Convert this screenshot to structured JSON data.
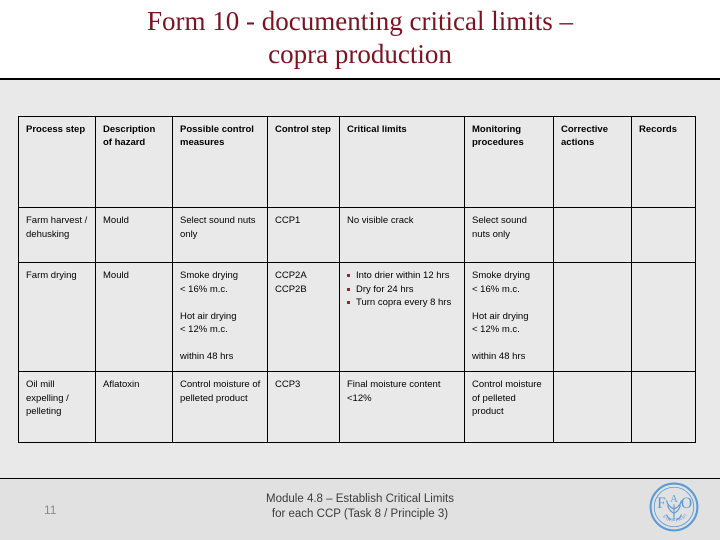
{
  "slide": {
    "title": "Form 10 - documenting critical limits –\ncopra production",
    "title_color": "#7b1220",
    "background_color": "#e9e9e9"
  },
  "table": {
    "headers": [
      "Process step",
      "Description of hazard",
      "Possible control measures",
      "Control step",
      "Critical limits",
      "Monitoring procedures",
      "Corrective actions",
      "Records"
    ],
    "rows": [
      {
        "process_step": "Farm harvest / dehusking",
        "description_of_hazard": "Mould",
        "possible_control_measures": "Select sound nuts only",
        "control_step": "CCP1",
        "critical_limits": "No visible crack",
        "critical_limits_bullets": [],
        "monitoring_procedures": "Select sound nuts only",
        "corrective_actions": "",
        "records": ""
      },
      {
        "process_step": "Farm drying",
        "description_of_hazard": "Mould",
        "possible_control_measures": "Smoke drying\n< 16% m.c.\n\nHot air drying\n< 12% m.c.\n\nwithin 48 hrs",
        "control_step": "CCP2A\nCCP2B",
        "critical_limits": "",
        "critical_limits_bullets": [
          "Into drier within 12 hrs",
          "Dry for 24 hrs",
          "Turn copra every 8 hrs"
        ],
        "monitoring_procedures": "Smoke drying\n< 16% m.c.\n\nHot air drying\n< 12% m.c.\n\nwithin 48 hrs",
        "corrective_actions": "",
        "records": ""
      },
      {
        "process_step": "Oil mill expelling / pelleting",
        "description_of_hazard": "Aflatoxin",
        "possible_control_measures": "Control moisture of pelleted product",
        "control_step": "CCP3",
        "critical_limits": "Final moisture content <12%",
        "critical_limits_bullets": [],
        "monitoring_procedures": "Control moisture of pelleted product",
        "corrective_actions": "",
        "records": ""
      }
    ],
    "bullet_color": "#8c2b2b"
  },
  "footer": {
    "page_number": "11",
    "text": "Module 4.8 – Establish Critical Limits\nfor each CCP (Task 8 / Principle 3)",
    "logo": {
      "name": "fao-logo",
      "letters": "FAO",
      "motto": "FIAT PANIS",
      "color": "#5b9bd5"
    }
  }
}
